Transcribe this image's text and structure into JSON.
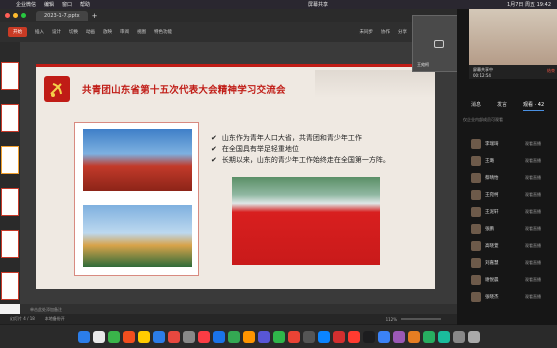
{
  "menubar": {
    "app": "企业微信",
    "menus": [
      "编辑",
      "窗口",
      "帮助"
    ],
    "center": "屏幕共享",
    "datetime": "1月7日 周五 19:42"
  },
  "wps": {
    "file_tab": "2023-1-7.pptx",
    "ribbon": [
      "开始",
      "插入",
      "设计",
      "切换",
      "动画",
      "放映",
      "审阅",
      "视图",
      "特色功能"
    ],
    "ribbon_right": [
      "未同步",
      "协作",
      "分享"
    ],
    "slide": {
      "title": "共青团山东省第十五次代表大会精神学习交流会",
      "bullets": [
        "山东作为青年人口大省，共青团和青少年工作",
        "在全国具有举足轻重地位",
        "长期以来，山东的青少年工作始终走在全国第一方阵。"
      ]
    },
    "notes_placeholder": "单击此处添加备注",
    "status": [
      "幻灯片 4 / 18",
      "本地备份开"
    ],
    "zoom": "112%"
  },
  "float": {
    "name": "王宛柯"
  },
  "call": {
    "live_label": "屏幕共享中",
    "live_time": "00:12:54",
    "end_label": "结束",
    "tabs": [
      "消息",
      "发言",
      "观看 · 42"
    ],
    "note": "仅企业内部成员可观看",
    "members": [
      {
        "name": "李瑞琦",
        "status": "观看直播"
      },
      {
        "name": "王璐",
        "status": "观看直播"
      },
      {
        "name": "蔡晴怡",
        "status": "观看直播"
      },
      {
        "name": "王宛柯",
        "status": "观看直播"
      },
      {
        "name": "王泥轩",
        "status": "观看直播"
      },
      {
        "name": "张鹏",
        "status": "观看直播"
      },
      {
        "name": "高晓萱",
        "status": "观看直播"
      },
      {
        "name": "刘嘉慧",
        "status": "观看直播"
      },
      {
        "name": "谢悦晨",
        "status": "观看直播"
      },
      {
        "name": "张晓杰",
        "status": "观看直播"
      }
    ]
  },
  "colors": {
    "accent": "#c93b25",
    "slide_red": "#c01c16"
  }
}
